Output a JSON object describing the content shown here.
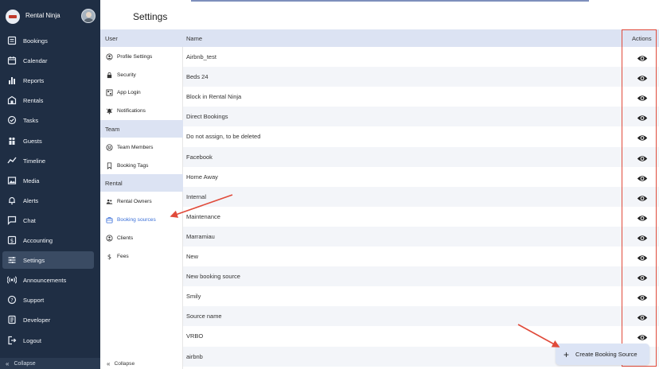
{
  "app": {
    "brand_name": "Rental Ninja",
    "page_title": "Settings"
  },
  "colors": {
    "sidebar_bg": "#1f2e44",
    "accent_blue": "#3a6fd8",
    "header_bg": "#dce3f3",
    "annotation_red": "#e04a3a"
  },
  "sidebar": {
    "items": [
      {
        "label": "Bookings",
        "icon": "bookings-icon"
      },
      {
        "label": "Calendar",
        "icon": "calendar-icon"
      },
      {
        "label": "Reports",
        "icon": "reports-icon"
      },
      {
        "label": "Rentals",
        "icon": "rentals-icon"
      },
      {
        "label": "Tasks",
        "icon": "tasks-icon"
      },
      {
        "label": "Guests",
        "icon": "guests-icon"
      },
      {
        "label": "Timeline",
        "icon": "timeline-icon"
      },
      {
        "label": "Media",
        "icon": "media-icon"
      },
      {
        "label": "Alerts",
        "icon": "alerts-icon"
      },
      {
        "label": "Chat",
        "icon": "chat-icon"
      },
      {
        "label": "Accounting",
        "icon": "accounting-icon"
      },
      {
        "label": "Settings",
        "icon": "settings-icon",
        "active": true
      },
      {
        "label": "Announcements",
        "icon": "announcements-icon"
      },
      {
        "label": "Support",
        "icon": "support-icon"
      },
      {
        "label": "Developer",
        "icon": "developer-icon"
      },
      {
        "label": "Logout",
        "icon": "logout-icon"
      }
    ],
    "collapse_label": "Collapse"
  },
  "submenu": {
    "sections": [
      {
        "title": "User",
        "items": [
          {
            "label": "Profile Settings",
            "icon": "profile-icon"
          },
          {
            "label": "Security",
            "icon": "lock-icon"
          },
          {
            "label": "App Login",
            "icon": "app-login-icon"
          },
          {
            "label": "Notifications",
            "icon": "bell-icon"
          }
        ]
      },
      {
        "title": "Team",
        "items": [
          {
            "label": "Team Members",
            "icon": "team-icon"
          },
          {
            "label": "Booking Tags",
            "icon": "bookmark-icon"
          }
        ]
      },
      {
        "title": "Rental",
        "items": [
          {
            "label": "Rental Owners",
            "icon": "owners-icon"
          },
          {
            "label": "Booking sources",
            "icon": "booking-sources-icon",
            "active": true
          },
          {
            "label": "Clients",
            "icon": "clients-icon"
          },
          {
            "label": "Fees",
            "icon": "dollar-icon"
          }
        ]
      }
    ],
    "collapse_label": "Collapse"
  },
  "table": {
    "columns": {
      "name": "Name",
      "actions": "Actions"
    },
    "rows": [
      "Airbnb_test",
      "Beds 24",
      "Block in Rental Ninja",
      "Direct Bookings",
      "Do not assign, to be deleted",
      "Facebook",
      "Home Away",
      "Internal",
      "Maintenance",
      "Marramiau",
      "New",
      "New booking source",
      "Smily",
      "Source name",
      "VRBO",
      "airbnb"
    ]
  },
  "create_button": {
    "label": "Create Booking Source",
    "icon": "plus-icon"
  }
}
